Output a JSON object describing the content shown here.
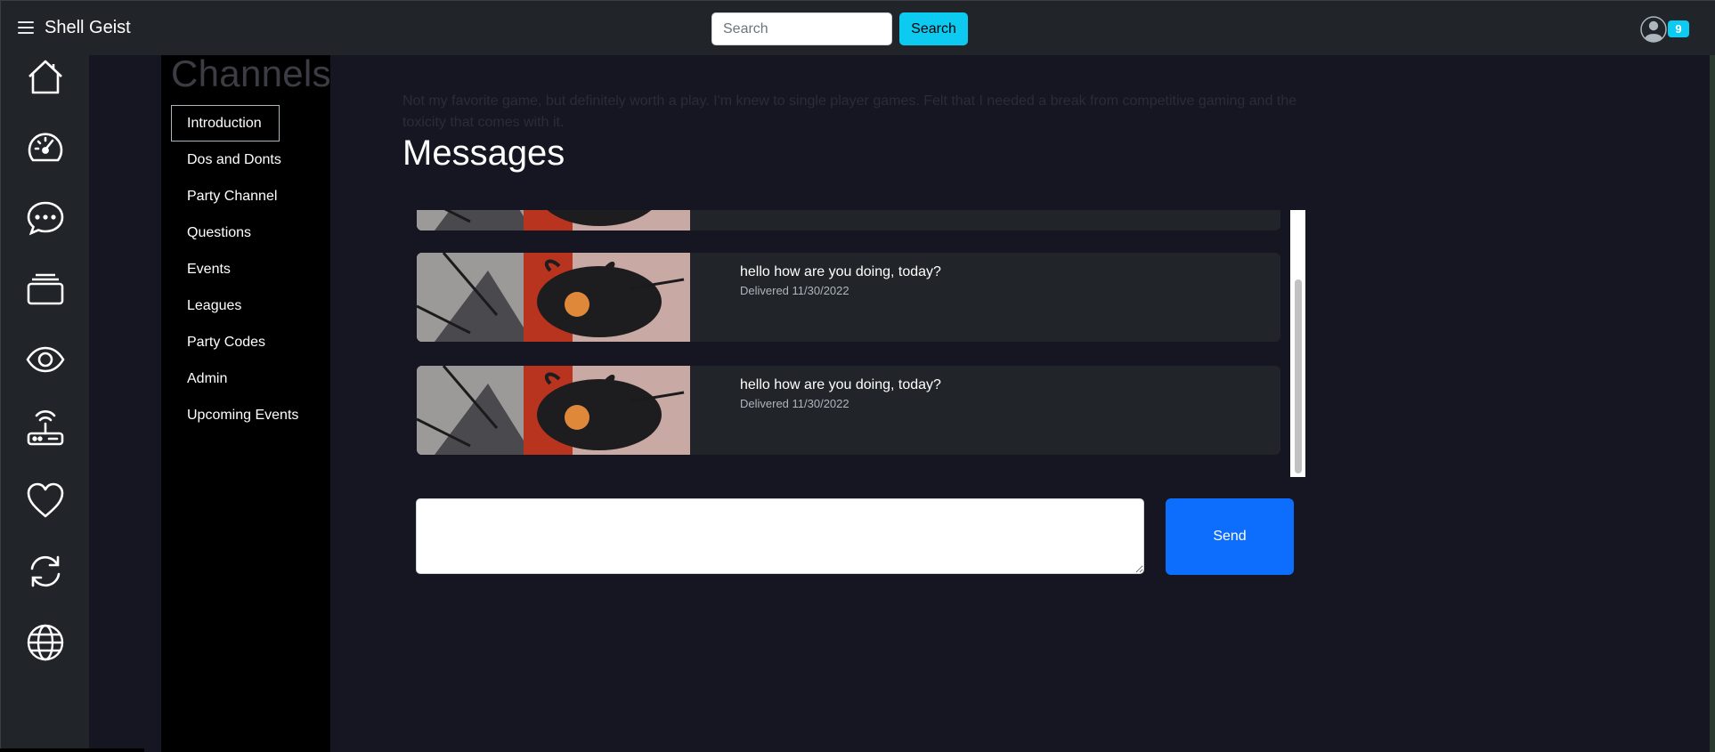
{
  "navbar": {
    "brand": "Shell Geist",
    "search_placeholder": "Search",
    "search_button": "Search",
    "notification_count": "9",
    "colors": {
      "background": "#212529",
      "accent": "#0dcaf0"
    }
  },
  "icon_rail": {
    "items": [
      {
        "icon": "home-icon"
      },
      {
        "icon": "speedometer-icon"
      },
      {
        "icon": "chat-dots-icon"
      },
      {
        "icon": "collection-icon"
      },
      {
        "icon": "eye-icon"
      },
      {
        "icon": "router-icon"
      },
      {
        "icon": "heart-icon"
      },
      {
        "icon": "refresh-icon"
      },
      {
        "icon": "globe-icon"
      }
    ]
  },
  "channels": {
    "title": "Channels",
    "active": "Introduction",
    "items": [
      {
        "label": "Introduction"
      },
      {
        "label": "Dos and Donts"
      },
      {
        "label": "Party Channel"
      },
      {
        "label": "Questions"
      },
      {
        "label": "Events"
      },
      {
        "label": "Leagues"
      },
      {
        "label": "Party Codes"
      },
      {
        "label": "Admin"
      },
      {
        "label": "Upcoming Events"
      }
    ]
  },
  "main": {
    "faded_text": "Not my favorite game, but definitely worth a play. I'm knew to single player games. Felt that I needed a break from competitive gaming and the toxicity that comes with it.",
    "messages_title": "Messages",
    "messages": [
      {
        "text": "",
        "status": ""
      },
      {
        "text": "hello how are you doing, today?",
        "status": "Delivered 11/30/2022"
      },
      {
        "text": "hello how are you doing, today?",
        "status": "Delivered 11/30/2022"
      }
    ],
    "composer": {
      "value": "",
      "send_label": "Send",
      "send_color": "#0d6efd"
    }
  }
}
